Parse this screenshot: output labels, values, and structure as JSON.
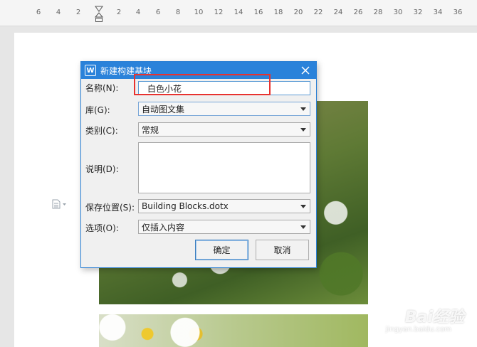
{
  "ruler": {
    "ticks": [
      "6",
      "4",
      "2",
      "2",
      "4",
      "6",
      "8",
      "10",
      "12",
      "14",
      "16",
      "18",
      "20",
      "22",
      "24",
      "26",
      "28",
      "30",
      "32",
      "34",
      "36"
    ]
  },
  "dialog": {
    "title": "新建构建基块",
    "app_icon_letter": "W",
    "name_label": "名称(N):",
    "name_value": "白色小花",
    "gallery_label": "库(G):",
    "gallery_value": "自动图文集",
    "category_label": "类别(C):",
    "category_value": "常规",
    "description_label": "说明(D):",
    "description_value": "",
    "save_label": "保存位置(S):",
    "save_value": "Building Blocks.dotx",
    "options_label": "选项(O):",
    "options_value": "仅插入内容",
    "ok_label": "确定",
    "cancel_label": "取消"
  },
  "watermark": {
    "brand": "Bai经验",
    "url": "jingyan.baidu.com"
  },
  "colors": {
    "titlebar": "#2a82da",
    "highlight": "#e8322f"
  }
}
